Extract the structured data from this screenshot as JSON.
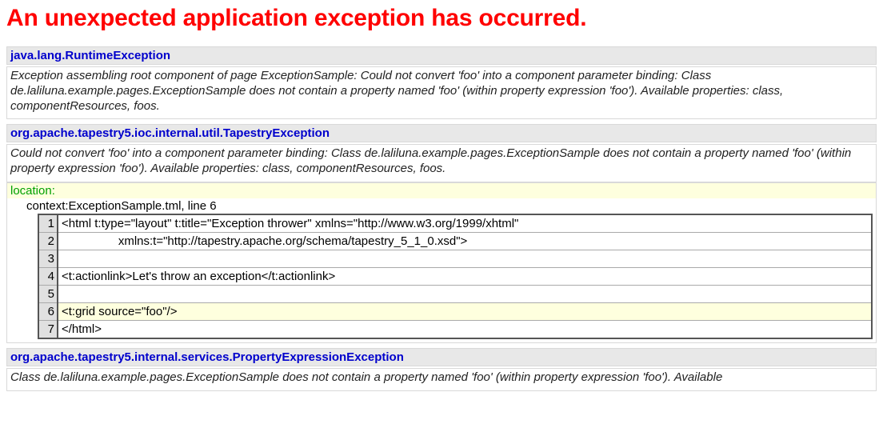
{
  "title": "An unexpected application exception has occurred.",
  "exceptions": [
    {
      "class": "java.lang.RuntimeException",
      "message": "Exception assembling root component of page ExceptionSample: Could not convert 'foo' into a component parameter binding: Class de.laliluna.example.pages.ExceptionSample does not contain a property named 'foo' (within property expression 'foo'). Available properties: class, componentResources, foos."
    },
    {
      "class": "org.apache.tapestry5.ioc.internal.util.TapestryException",
      "message": "Could not convert 'foo' into a component parameter binding: Class de.laliluna.example.pages.ExceptionSample does not contain a property named 'foo' (within property expression 'foo'). Available properties: class, componentResources, foos."
    },
    {
      "class": "org.apache.tapestry5.internal.services.PropertyExpressionException",
      "message": "Class de.laliluna.example.pages.ExceptionSample does not contain a property named 'foo' (within property expression 'foo'). Available"
    }
  ],
  "location": {
    "label": "location:",
    "text": "context:ExceptionSample.tml, line 6",
    "highlight": 6,
    "lines": [
      {
        "n": "1",
        "code": "<html t:type=\"layout\" t:title=\"Exception thrower\" xmlns=\"http://www.w3.org/1999/xhtml\""
      },
      {
        "n": "2",
        "code": "                 xmlns:t=\"http://tapestry.apache.org/schema/tapestry_5_1_0.xsd\">"
      },
      {
        "n": "3",
        "code": ""
      },
      {
        "n": "4",
        "code": "<t:actionlink>Let's throw an exception</t:actionlink>"
      },
      {
        "n": "5",
        "code": ""
      },
      {
        "n": "6",
        "code": "<t:grid source=\"foo\"/>"
      },
      {
        "n": "7",
        "code": "</html>"
      }
    ]
  }
}
